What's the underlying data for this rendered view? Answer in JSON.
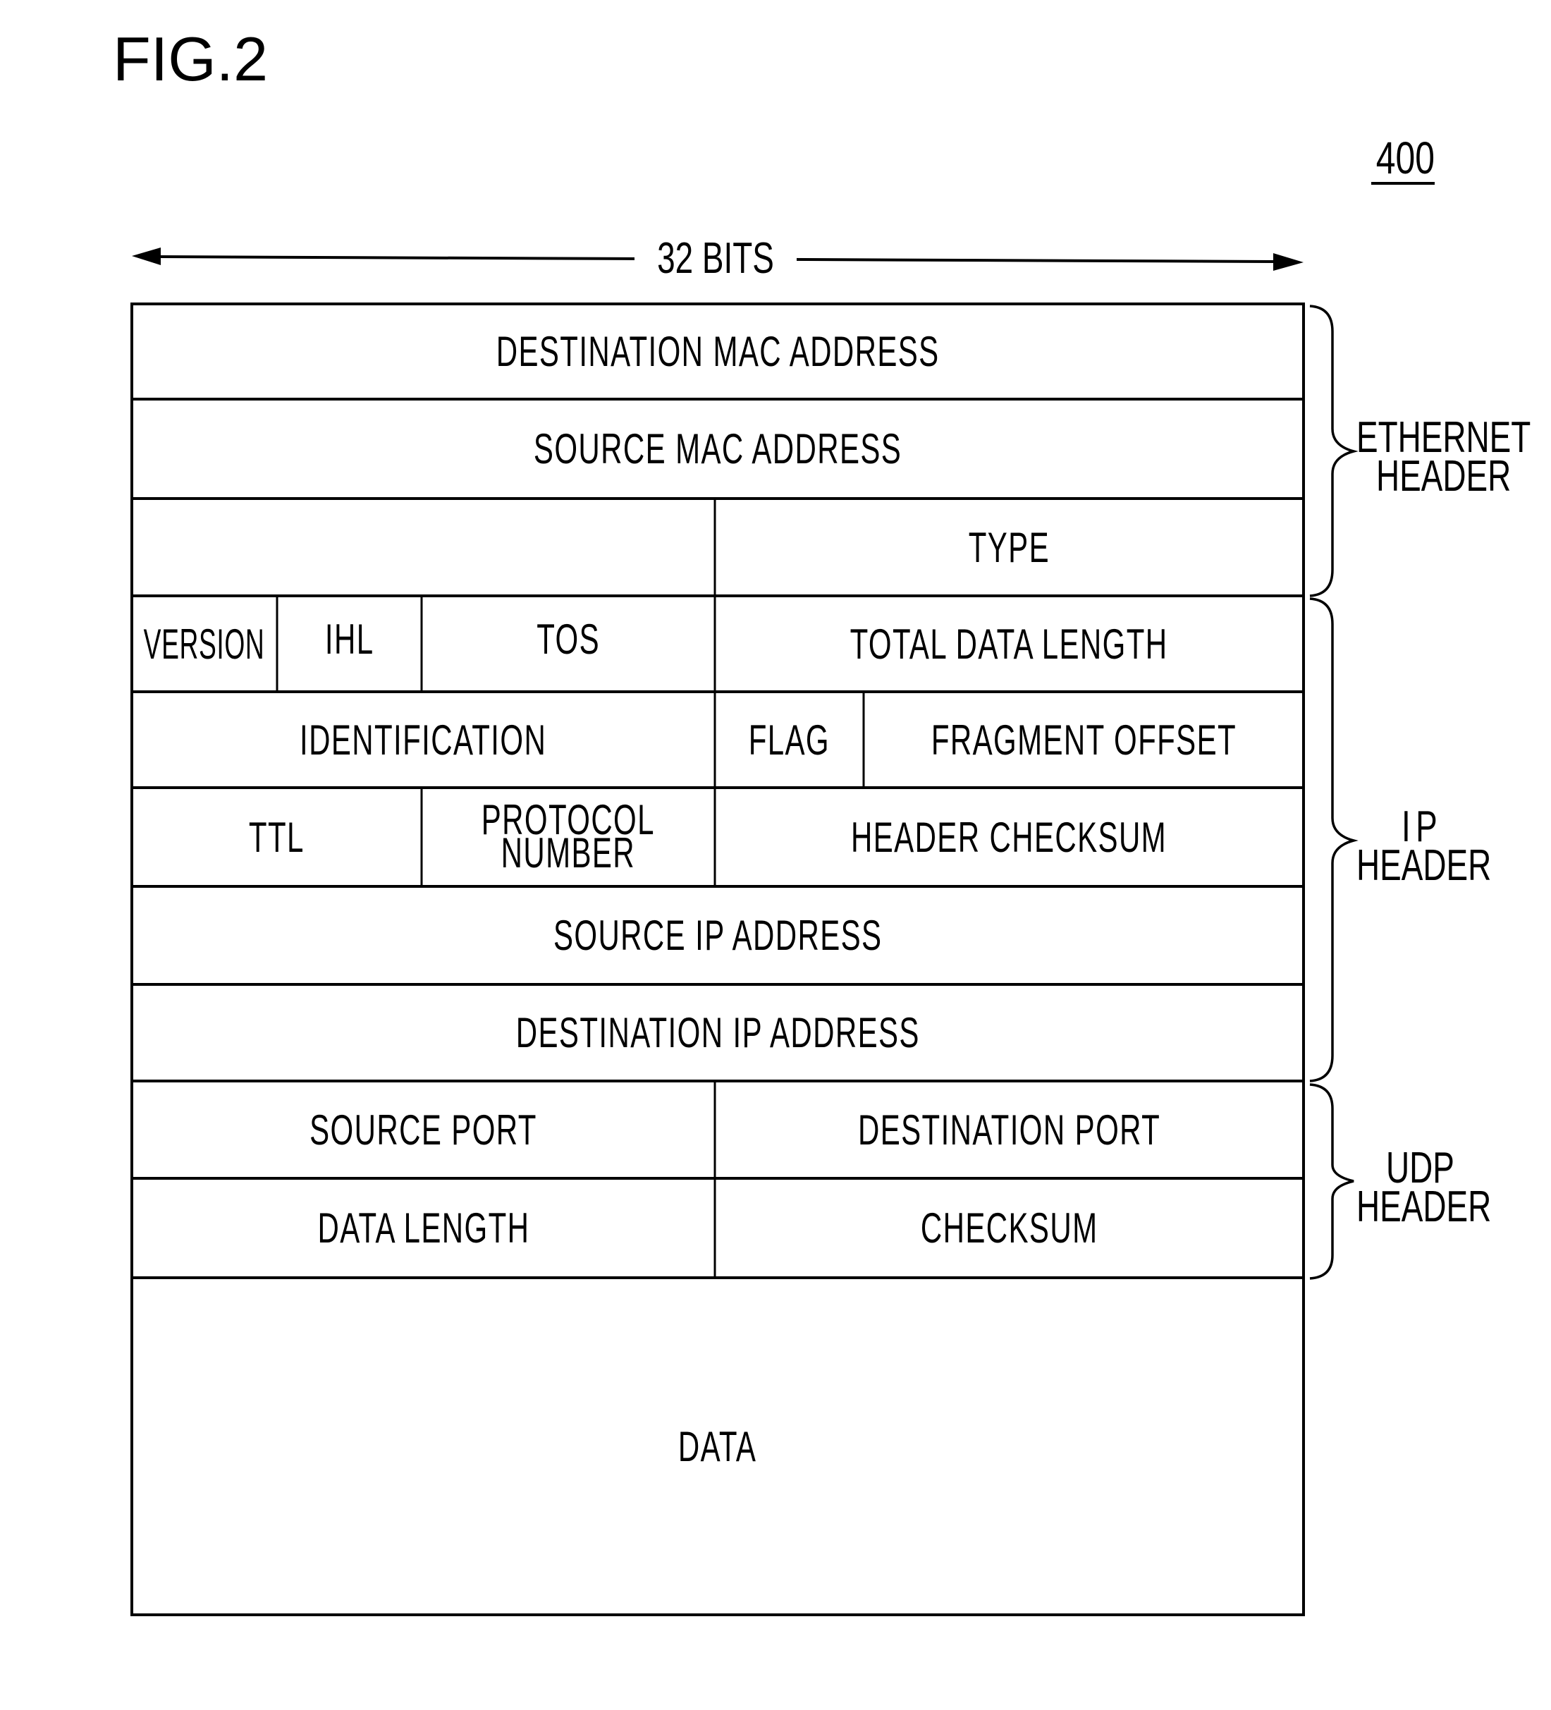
{
  "figure": {
    "title": "FIG.2",
    "reference_number": "400",
    "width_label": "32 BITS"
  },
  "packet": {
    "rows": [
      {
        "cells": [
          {
            "label": "DESTINATION MAC ADDRESS"
          }
        ]
      },
      {
        "cells": [
          {
            "label": "SOURCE MAC ADDRESS"
          }
        ]
      },
      {
        "cells": [
          {
            "label": ""
          },
          {
            "label": "TYPE"
          }
        ]
      },
      {
        "cells": [
          {
            "label": "VERSION"
          },
          {
            "label": "IHL"
          },
          {
            "label": "TOS"
          },
          {
            "label": "TOTAL DATA LENGTH"
          }
        ]
      },
      {
        "cells": [
          {
            "label": "IDENTIFICATION"
          },
          {
            "label": "FLAG"
          },
          {
            "label": "FRAGMENT OFFSET"
          }
        ]
      },
      {
        "cells": [
          {
            "label": "TTL"
          },
          {
            "label": "PROTOCOL\nNUMBER"
          },
          {
            "label": "HEADER CHECKSUM"
          }
        ]
      },
      {
        "cells": [
          {
            "label": "SOURCE IP ADDRESS"
          }
        ]
      },
      {
        "cells": [
          {
            "label": "DESTINATION IP ADDRESS"
          }
        ]
      },
      {
        "cells": [
          {
            "label": "SOURCE PORT"
          },
          {
            "label": "DESTINATION PORT"
          }
        ]
      },
      {
        "cells": [
          {
            "label": "DATA LENGTH"
          },
          {
            "label": "CHECKSUM"
          }
        ]
      },
      {
        "cells": [
          {
            "label": "DATA"
          }
        ]
      }
    ]
  },
  "groups": {
    "ethernet": {
      "line1": "ETHERNET",
      "line2": "HEADER"
    },
    "ip": {
      "line1": "IP",
      "line2": "HEADER"
    },
    "udp": {
      "line1": "UDP",
      "line2": "HEADER"
    }
  }
}
